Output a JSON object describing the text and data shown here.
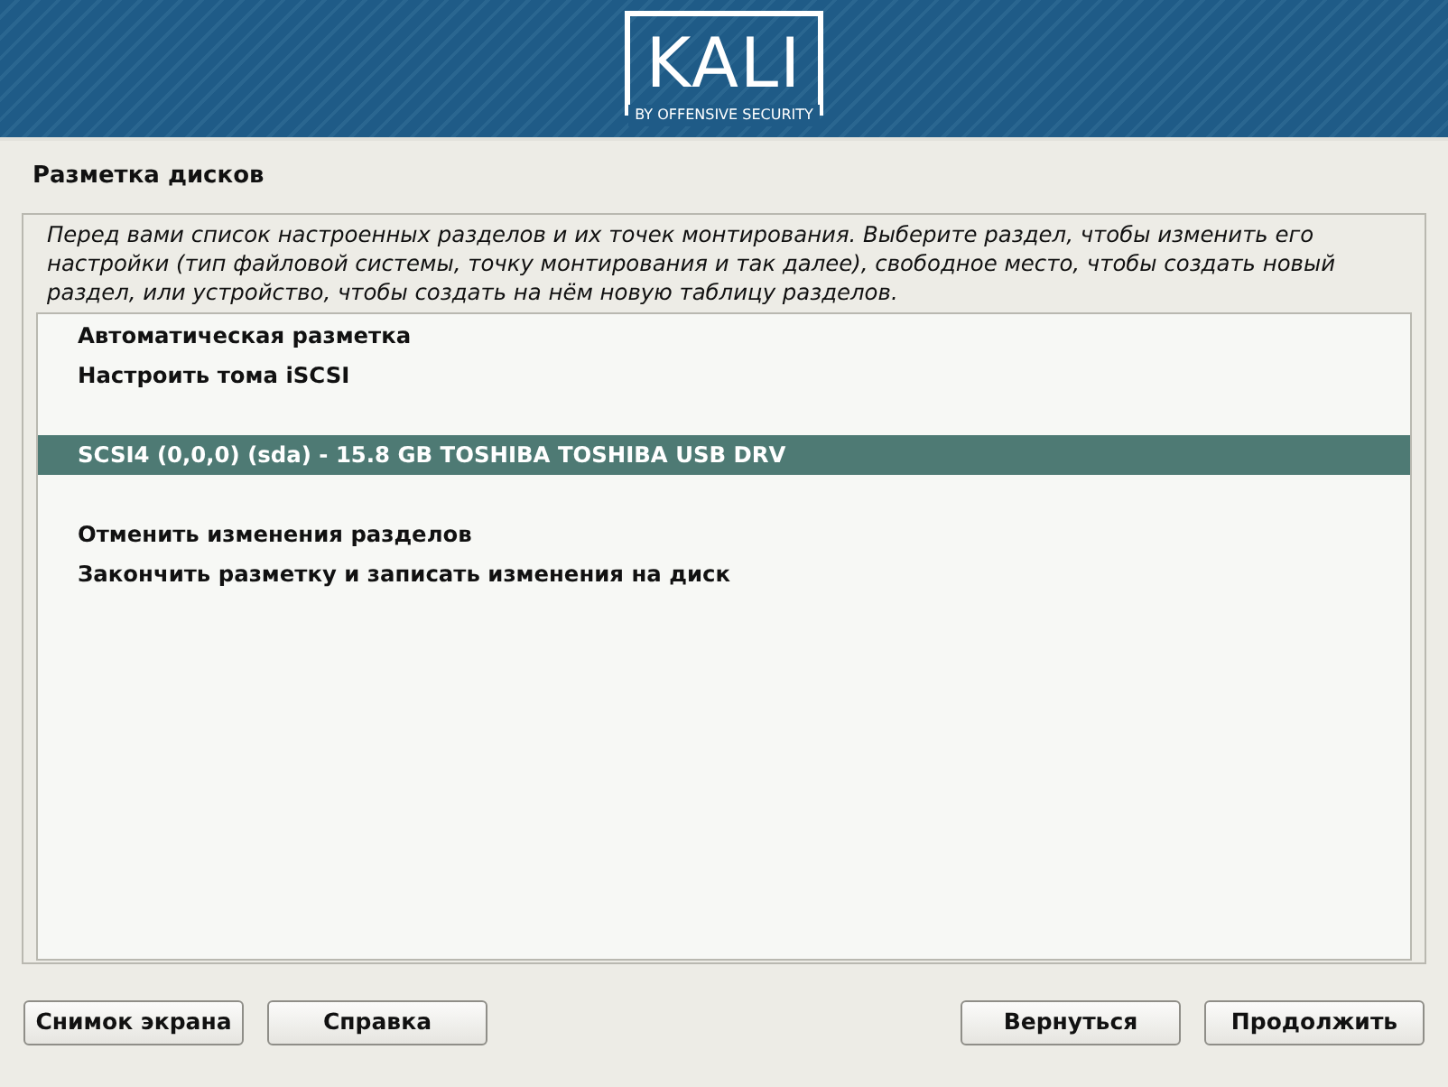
{
  "banner": {
    "logo": "KALI",
    "tagline": "BY OFFENSIVE SECURITY"
  },
  "title": "Разметка дисков",
  "description": "Перед вами список настроенных разделов и их точек монтирования. Выберите раздел, чтобы изменить его настройки (тип файловой системы, точку монтирования и так далее), свободное место, чтобы создать новый раздел, или устройство, чтобы создать на нём новую таблицу разделов.",
  "items": [
    {
      "kind": "option",
      "label": "Автоматическая разметка",
      "selected": false
    },
    {
      "kind": "option",
      "label": "Настроить тома iSCSI",
      "selected": false
    },
    {
      "kind": "gap"
    },
    {
      "kind": "option",
      "label": "SCSI4 (0,0,0) (sda) - 15.8 GB TOSHIBA TOSHIBA USB DRV",
      "selected": true
    },
    {
      "kind": "gap"
    },
    {
      "kind": "option",
      "label": "Отменить изменения разделов",
      "selected": false
    },
    {
      "kind": "option",
      "label": "Закончить разметку и записать изменения на диск",
      "selected": false
    }
  ],
  "buttons_left": [
    "Снимок экрана",
    "Справка"
  ],
  "buttons_right": [
    "Вернуться",
    "Продолжить"
  ]
}
